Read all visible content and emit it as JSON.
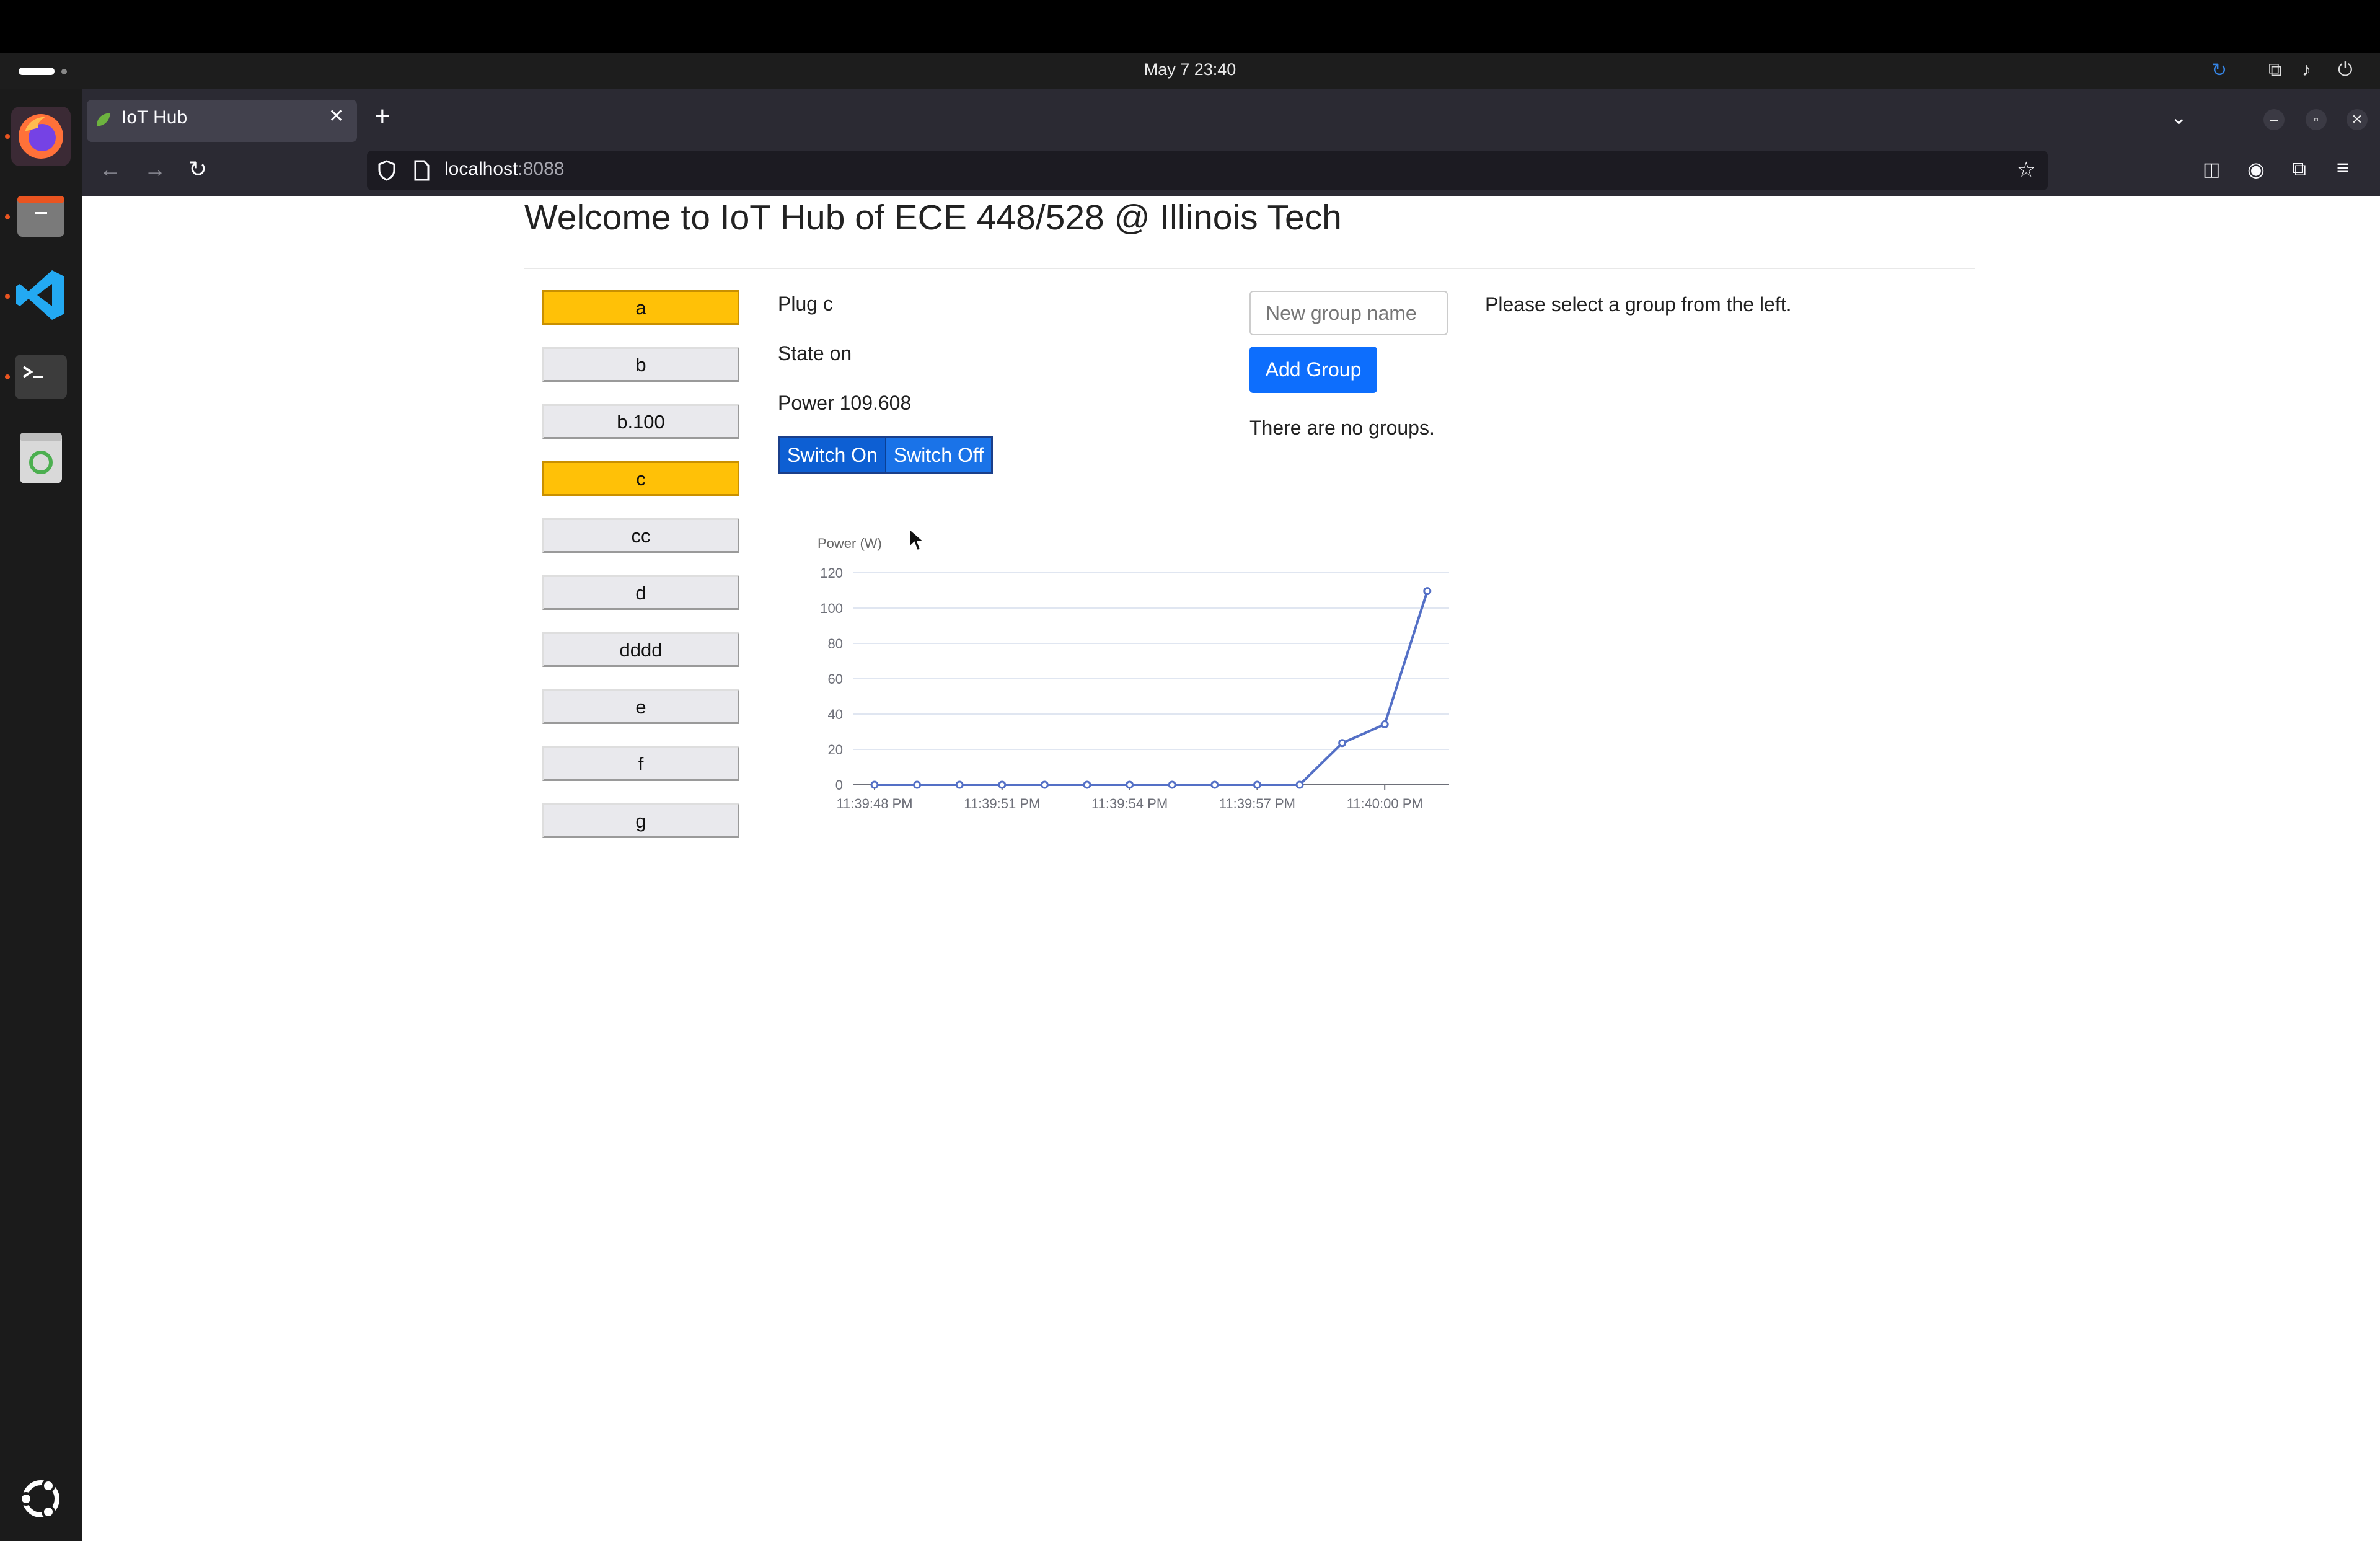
{
  "system": {
    "clock": "May 7  23:40"
  },
  "dock": {
    "apps": [
      "firefox-icon",
      "files-icon",
      "vscode-icon",
      "terminal-icon",
      "trash-icon",
      "ubuntu-icon"
    ]
  },
  "browser": {
    "tab_title": "IoT Hub",
    "url_host": "localhost",
    "url_port": ":8088"
  },
  "page": {
    "heading": "Welcome to IoT Hub of ECE 448/528 @ Illinois Tech",
    "plugs": [
      {
        "label": "a",
        "active": true
      },
      {
        "label": "b",
        "active": false
      },
      {
        "label": "b.100",
        "active": false
      },
      {
        "label": "c",
        "active": true
      },
      {
        "label": "cc",
        "active": false
      },
      {
        "label": "d",
        "active": false
      },
      {
        "label": "dddd",
        "active": false
      },
      {
        "label": "e",
        "active": false
      },
      {
        "label": "f",
        "active": false
      },
      {
        "label": "g",
        "active": false
      }
    ],
    "plug_name": "Plug c",
    "plug_state": "State on",
    "plug_power": "Power 109.608",
    "switch_on_label": "Switch On",
    "switch_off_label": "Switch Off",
    "group_input_placeholder": "New group name",
    "add_group_label": "Add Group",
    "no_groups_text": "There are no groups.",
    "select_group_text": "Please select a group from the left."
  },
  "chart_data": {
    "type": "line",
    "ylabel": "Power (W)",
    "ylim": [
      0,
      120
    ],
    "yticks": [
      0,
      20,
      40,
      60,
      80,
      100,
      120
    ],
    "xtick_labels": [
      "11:39:48 PM",
      "11:39:51 PM",
      "11:39:54 PM",
      "11:39:57 PM",
      "11:40:00 PM"
    ],
    "x": [
      "11:39:48 PM",
      "11:39:49 PM",
      "11:39:50 PM",
      "11:39:51 PM",
      "11:39:52 PM",
      "11:39:53 PM",
      "11:39:54 PM",
      "11:39:55 PM",
      "11:39:56 PM",
      "11:39:57 PM",
      "11:39:58 PM",
      "11:39:59 PM",
      "11:40:00 PM",
      "11:40:01 PM"
    ],
    "values": [
      0,
      0,
      0,
      0,
      0,
      0,
      0,
      0,
      0,
      0,
      0,
      23.6,
      34.2,
      109.6
    ],
    "color": "#5470c6",
    "grid": true
  }
}
